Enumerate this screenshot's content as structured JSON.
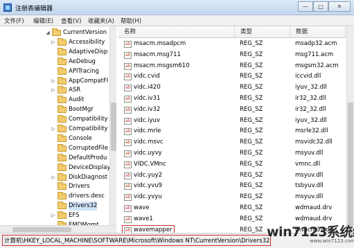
{
  "window": {
    "title": "注册表编辑器",
    "minimize": "—",
    "maximize": "□",
    "close": "✕"
  },
  "menu": [
    {
      "label": "文件(F)"
    },
    {
      "label": "编辑(E)"
    },
    {
      "label": "查看(V)"
    },
    {
      "label": "收藏夹(A)"
    },
    {
      "label": "帮助(H)"
    }
  ],
  "tree": {
    "items": [
      {
        "label": "CurrentVersion",
        "expander": "◢",
        "level": 0
      },
      {
        "label": "Accessibility",
        "expander": "▷",
        "level": 1
      },
      {
        "label": "AdaptiveDisp",
        "expander": "",
        "level": 1
      },
      {
        "label": "AeDebug",
        "expander": "",
        "level": 1
      },
      {
        "label": "APITracing",
        "expander": "",
        "level": 1
      },
      {
        "label": "AppCompatFl",
        "expander": "▷",
        "level": 1
      },
      {
        "label": "ASR",
        "expander": "▷",
        "level": 1
      },
      {
        "label": "Audit",
        "expander": "",
        "level": 1
      },
      {
        "label": "BootMgr",
        "expander": "",
        "level": 1
      },
      {
        "label": "Compatibility",
        "expander": "",
        "level": 1
      },
      {
        "label": "Compatibility",
        "expander": "▷",
        "level": 1
      },
      {
        "label": "Console",
        "expander": "",
        "level": 1
      },
      {
        "label": "CorruptedFile",
        "expander": "",
        "level": 1
      },
      {
        "label": "DefaultProdu",
        "expander": "",
        "level": 1
      },
      {
        "label": "DeviceDisplay",
        "expander": "",
        "level": 1
      },
      {
        "label": "DiskDiagnost",
        "expander": "▷",
        "level": 1
      },
      {
        "label": "Drivers",
        "expander": "",
        "level": 1
      },
      {
        "label": "drivers.desc",
        "expander": "",
        "level": 1
      },
      {
        "label": "Drivers32",
        "expander": "",
        "level": 1,
        "selected": true
      },
      {
        "label": "EFS",
        "expander": "▷",
        "level": 1
      },
      {
        "label": "EMDMgmt",
        "expander": "",
        "level": 1
      }
    ]
  },
  "list": {
    "headers": {
      "name": "名称",
      "type": "类型",
      "data": "数据"
    },
    "rows": [
      {
        "name": "msacm.msadpcm",
        "type": "REG_SZ",
        "data": "msadp32.acm"
      },
      {
        "name": "msacm.msg711",
        "type": "REG_SZ",
        "data": "msg711.acm"
      },
      {
        "name": "msacm.msgsm610",
        "type": "REG_SZ",
        "data": "msgsm32.acm"
      },
      {
        "name": "vidc.cvid",
        "type": "REG_SZ",
        "data": "iccvid.dll"
      },
      {
        "name": "vidc.i420",
        "type": "REG_SZ",
        "data": "iyuv_32.dll"
      },
      {
        "name": "vidc.iv31",
        "type": "REG_SZ",
        "data": "ir32_32.dll"
      },
      {
        "name": "vidc.iv32",
        "type": "REG_SZ",
        "data": "ir32_32.dll"
      },
      {
        "name": "vidc.iyuv",
        "type": "REG_SZ",
        "data": "iyuv_32.dll"
      },
      {
        "name": "vidc.mrle",
        "type": "REG_SZ",
        "data": "msrle32.dll"
      },
      {
        "name": "vidc.msvc",
        "type": "REG_SZ",
        "data": "msvidc32.dll"
      },
      {
        "name": "vidc.uyvy",
        "type": "REG_SZ",
        "data": "msyuv.dll"
      },
      {
        "name": "VIDC.VMnc",
        "type": "REG_SZ",
        "data": "vmnc.dll"
      },
      {
        "name": "vidc.yuy2",
        "type": "REG_SZ",
        "data": "msyuv.dll"
      },
      {
        "name": "vidc.yvu9",
        "type": "REG_SZ",
        "data": "tsbyuv.dll"
      },
      {
        "name": "vidc.yvyu",
        "type": "REG_SZ",
        "data": "msyuv.dll"
      },
      {
        "name": "wave",
        "type": "REG_SZ",
        "data": "wdmaud.drv"
      },
      {
        "name": "wave1",
        "type": "REG_SZ",
        "data": "wdmaud.drv"
      },
      {
        "name": "wavemapper",
        "type": "REG_SZ",
        "data": "msacm32.drv",
        "highlighted": true
      }
    ],
    "value_icon": "ab"
  },
  "status": {
    "path": "计算机\\HKEY_LOCAL_MACHINE\\SOFTWARE\\Microsoft\\Windows NT\\CurrentVersion\\Drivers32"
  },
  "watermark": {
    "main": "win7123系统统",
    "sub": "www.win7123.com"
  },
  "colors": {
    "highlight_border": "#d12d2d",
    "folder": "#f2cc6e",
    "titlebar": "#c4d8ee"
  }
}
